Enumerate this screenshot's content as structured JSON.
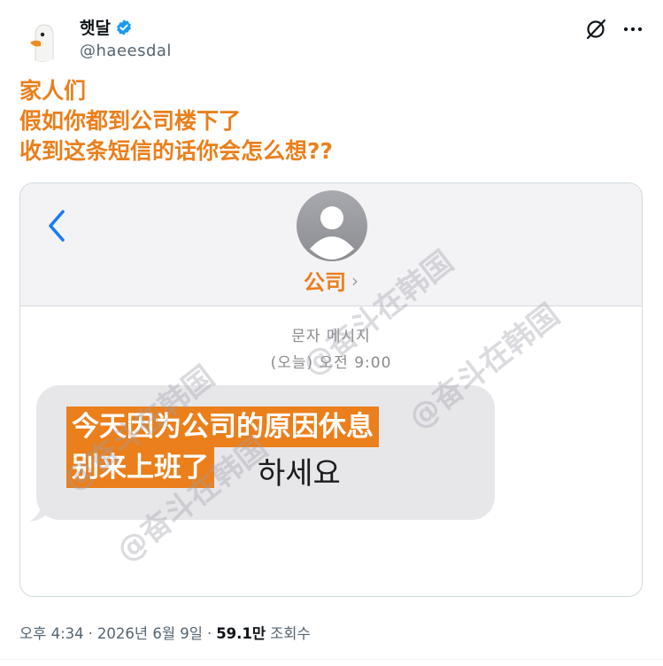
{
  "author": {
    "display_name": "햇달",
    "handle": "@haeesdal",
    "verified_color": "#1d9bf0"
  },
  "caption": {
    "lines": [
      "家人们",
      "假如你都到公司楼下了",
      "收到这条短信的话你会怎么想??"
    ],
    "color": "#ea7f1b"
  },
  "media": {
    "contact_name": "公司",
    "contact_chevron": "›",
    "message_type": "문자 메시지",
    "message_time": "(오늘) 오전 9:00",
    "bubble_visible_text": "하세요",
    "overlay_lines": [
      "今天因为公司的原因休息",
      "别来上班了"
    ],
    "watermark": "@奋斗在韩国"
  },
  "footer": {
    "time": "오후 4:34",
    "separator": "·",
    "date": "2026년 6월 9일",
    "views_count": "59.1만",
    "views_label": "조회수"
  },
  "icons": [
    "grok-icon",
    "more-icon",
    "back-icon",
    "verified-badge-icon",
    "contact-person-icon"
  ]
}
